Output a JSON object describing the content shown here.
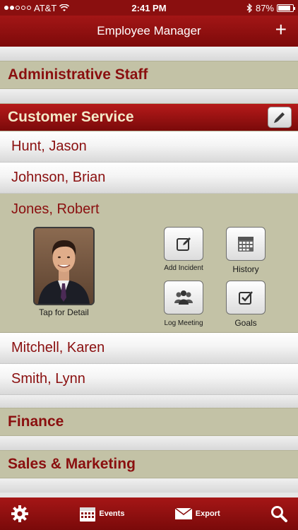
{
  "status": {
    "carrier": "AT&T",
    "time": "2:41 PM",
    "battery": "87%",
    "battery_level": 0.87
  },
  "nav": {
    "title": "Employee Manager",
    "add_icon": "+"
  },
  "sections": [
    {
      "name": "Administrative Staff"
    },
    {
      "name": "Customer Service"
    },
    {
      "name": "Finance"
    },
    {
      "name": "Sales & Marketing"
    }
  ],
  "employees": [
    "Hunt, Jason",
    "Johnson, Brian",
    "Jones, Robert",
    "Mitchell, Karen",
    "Smith, Lynn"
  ],
  "detail": {
    "tap_label": "Tap for Detail",
    "actions": [
      {
        "label": "Add Incident",
        "icon": "edit-icon"
      },
      {
        "label": "History",
        "icon": "calendar-icon"
      },
      {
        "label": "Log Meeting",
        "icon": "people-icon"
      },
      {
        "label": "Goals",
        "icon": "checkbox-icon"
      }
    ]
  },
  "tabbar": {
    "events": "Events",
    "export": "Export"
  },
  "colors": {
    "brand": "#8a0f0f",
    "section_bg": "#c3c2a6",
    "active_text": "#f3e9c8"
  }
}
